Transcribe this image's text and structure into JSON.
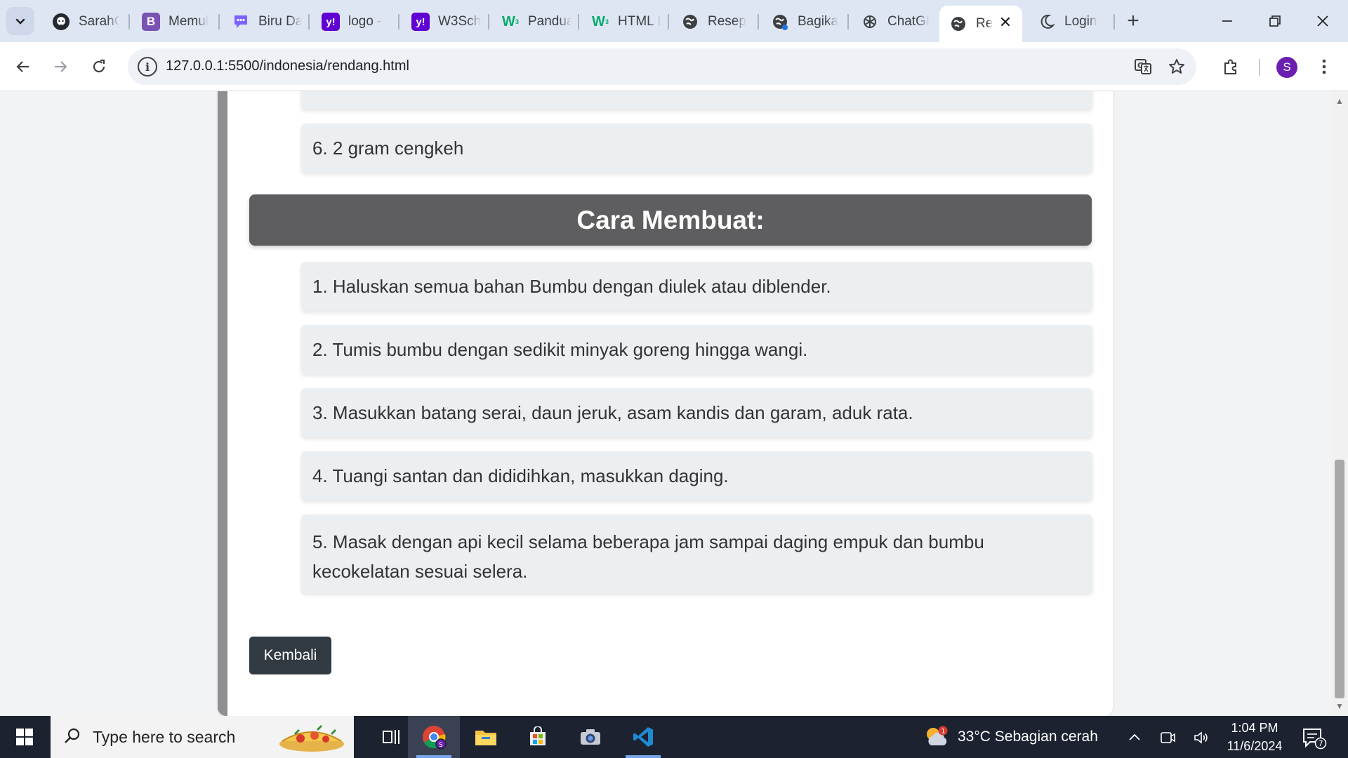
{
  "browser": {
    "tabs": [
      {
        "title": "SarahC",
        "icon": "github-icon",
        "color": "#24292f"
      },
      {
        "title": "Memul",
        "icon": "bootstrap-icon",
        "color": "#7952b3"
      },
      {
        "title": "Biru Da",
        "icon": "chat-bubble-icon",
        "color": "#7b61ff"
      },
      {
        "title": "logo -",
        "icon": "yahoo-icon",
        "color": "#6001d2"
      },
      {
        "title": "W3Sch",
        "icon": "yahoo-icon",
        "color": "#6001d2"
      },
      {
        "title": "Pandua",
        "icon": "w3schools-icon",
        "color": "#04aa6d"
      },
      {
        "title": "HTML I",
        "icon": "w3schools-icon",
        "color": "#04aa6d"
      },
      {
        "title": "Resep",
        "icon": "globe-icon",
        "color": "#3c4043"
      },
      {
        "title": "Bagika",
        "icon": "globe-icon",
        "color": "#3c4043"
      },
      {
        "title": "ChatGI",
        "icon": "openai-icon",
        "color": "#3c4043"
      },
      {
        "title": "Re",
        "icon": "globe-icon",
        "color": "#3c4043",
        "active": true
      },
      {
        "title": "Login",
        "icon": "moon-icon",
        "color": "#3c4043"
      }
    ],
    "address": "127.0.0.1:5500/indonesia/rendang.html",
    "profile_initial": "S"
  },
  "page": {
    "ingredient_last": "6. 2 gram cengkeh",
    "method_heading": "Cara Membuat:",
    "steps": [
      "1. Haluskan semua bahan Bumbu dengan diulek atau diblender.",
      "2. Tumis bumbu dengan sedikit minyak goreng hingga wangi.",
      "3. Masukkan batang serai, daun jeruk, asam kandis dan garam, aduk rata.",
      "4. Tuangi santan dan dididihkan, masukkan daging.",
      "5. Masak dengan api kecil selama beberapa jam sampai daging empuk dan bumbu kecokelatan sesuai selera."
    ],
    "back_button": "Kembali"
  },
  "taskbar": {
    "search_placeholder": "Type here to search",
    "weather": "33°C  Sebagian cerah",
    "weather_badge": "1",
    "time": "1:04 PM",
    "date": "11/6/2024",
    "notification_count": "7"
  },
  "colors": {
    "heading_bg": "#5e5d5f",
    "item_bg": "#eceff1",
    "button_bg": "#323a42",
    "card_border": "#8f8f91"
  }
}
